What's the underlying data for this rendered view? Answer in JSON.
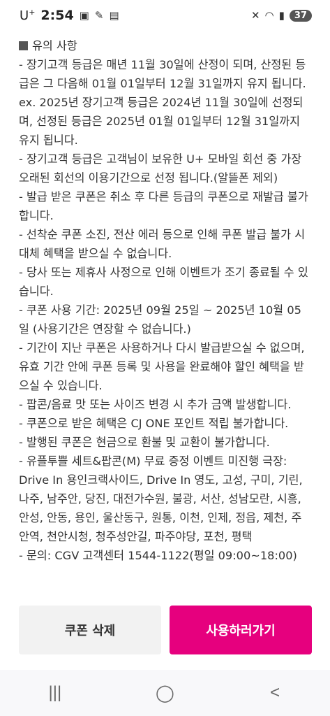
{
  "status": {
    "carrier": "U",
    "carrier_sup": "+",
    "time": "2:54",
    "battery": "37"
  },
  "notice": {
    "title": "유의 사항",
    "lines": [
      "- 장기고객 등급은 매년 11월 30일에 산정이 되며, 산정된 등급은 그 다음해 01월 01일부터 12월 31일까지 유지 됩니다.",
      "ex. 2025년 장기고객 등급은 2024년 11월 30일에 선정되며, 선정된 등급은 2025년 01월 01일부터 12월 31일까지 유지 됩니다.",
      "- 장기고객 등급은 고객님이 보유한 U+ 모바일 회선 중 가장 오래된 회선의 이용기간으로 선정 됩니다.(알뜰폰 제외)",
      "- 발급 받은 쿠폰은 취소 후 다른 등급의 쿠폰으로 재발급 불가합니다.",
      "- 선착순 쿠폰 소진, 전산 에러 등으로 인해 쿠폰 발급 불가 시 대체 혜택을 받으실 수 없습니다.",
      "- 당사 또는 제휴사 사정으로 인해 이벤트가 조기 종료될 수 있습니다.",
      "- 쿠폰 사용 기간: 2025년 09월 25일 ~ 2025년 10월 05일 (사용기간은 연장할 수 없습니다.)",
      "- 기간이 지난 쿠폰은 사용하거나 다시 발급받으실 수 없으며, 유효 기간 안에 쿠폰 등록 및 사용을 완료해야 할인 혜택을 받으실 수 있습니다.",
      "- 팝콘/음료 맛 또는 사이즈 변경 시 추가 금액 발생합니다.",
      "- 쿠폰으로 받은 혜택은 CJ ONE 포인트 적립 불가합니다.",
      "- 발행된 쿠폰은 현금으로 환불 및 교환이 불가합니다.",
      "- 유플투쁠 세트&팝콘(M) 무료 증정 이벤트 미진행 극장: Drive In 용인크랙사이드, Drive In 영도, 고성, 구미, 기린, 나주, 남주안, 당진, 대전가수원, 불광, 서산, 성남모란, 시흥, 안성, 안동, 용인, 울산동구, 원통, 이천, 인제, 정읍, 제천, 주안역, 천안시청, 청주성안길, 파주야당, 포천, 평택",
      "- 문의: CGV 고객센터 1544-1122(평일 09:00~18:00)"
    ]
  },
  "buttons": {
    "delete_label": "쿠폰 삭제",
    "use_label": "사용하러가기"
  },
  "colors": {
    "accent": "#e6007e",
    "delete_bg": "#f2f2f2"
  },
  "navbar": {
    "recent_icon": "recent-apps-icon",
    "home_icon": "home-icon",
    "back_icon": "back-icon"
  }
}
